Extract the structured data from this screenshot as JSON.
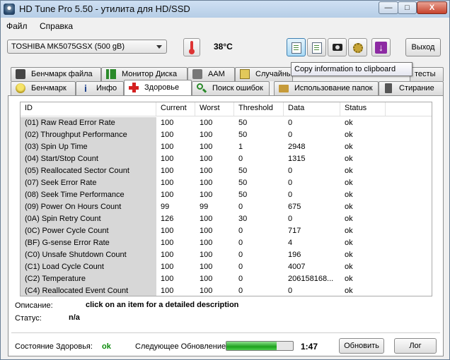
{
  "window": {
    "title": "HD Tune Pro 5.50 - утилита для HD/SSD",
    "minimize": "—",
    "maximize": "□",
    "close": "X"
  },
  "menu": {
    "file": "Файл",
    "help": "Справка"
  },
  "toolbar": {
    "drive": "TOSHIBA MK5075GSX (500 gB)",
    "temperature": "38°C",
    "exit_label": "Выход",
    "exit_icon": "exit-arrow-icon"
  },
  "tooltip": "Copy information to clipboard",
  "tabs_row1": [
    "Бенчмарк файла",
    "Монитор Диска",
    "AAM",
    "Случайный",
    "тесты"
  ],
  "tabs_row2": [
    "Бенчмарк",
    "Инфо",
    "Здоровье",
    "Поиск ошибок",
    "Использование папок",
    "Стирание"
  ],
  "selected_tab": "Здоровье",
  "table": {
    "headers": [
      "ID",
      "Current",
      "Worst",
      "Threshold",
      "Data",
      "Status"
    ],
    "rows": [
      [
        "(01) Raw Read Error Rate",
        "100",
        "100",
        "50",
        "0",
        "ok"
      ],
      [
        "(02) Throughput Performance",
        "100",
        "100",
        "50",
        "0",
        "ok"
      ],
      [
        "(03) Spin Up Time",
        "100",
        "100",
        "1",
        "2948",
        "ok"
      ],
      [
        "(04) Start/Stop Count",
        "100",
        "100",
        "0",
        "1315",
        "ok"
      ],
      [
        "(05) Reallocated Sector Count",
        "100",
        "100",
        "50",
        "0",
        "ok"
      ],
      [
        "(07) Seek Error Rate",
        "100",
        "100",
        "50",
        "0",
        "ok"
      ],
      [
        "(08) Seek Time Performance",
        "100",
        "100",
        "50",
        "0",
        "ok"
      ],
      [
        "(09) Power On Hours Count",
        "99",
        "99",
        "0",
        "675",
        "ok"
      ],
      [
        "(0A) Spin Retry Count",
        "126",
        "100",
        "30",
        "0",
        "ok"
      ],
      [
        "(0C) Power Cycle Count",
        "100",
        "100",
        "0",
        "717",
        "ok"
      ],
      [
        "(BF) G-sense Error Rate",
        "100",
        "100",
        "0",
        "4",
        "ok"
      ],
      [
        "(C0) Unsafe Shutdown Count",
        "100",
        "100",
        "0",
        "196",
        "ok"
      ],
      [
        "(C1) Load Cycle Count",
        "100",
        "100",
        "0",
        "4007",
        "ok"
      ],
      [
        "(C2) Temperature",
        "100",
        "100",
        "0",
        "206158168...",
        "ok"
      ],
      [
        "(C4) Reallocated Event Count",
        "100",
        "100",
        "0",
        "0",
        "ok"
      ]
    ]
  },
  "description": {
    "label": "Описание:",
    "value": "click on an item for a detailed description",
    "status_label": "Статус:",
    "status_value": "n/a"
  },
  "footer": {
    "health_label": "Состояние Здоровья:",
    "health_value": "ok",
    "health_color": "#0a8a0a",
    "next_update_label": "Следующее Обновление:",
    "progress_fraction": 0.76,
    "time": "1:47",
    "refresh_label": "Обновить",
    "log_label": "Лог"
  }
}
